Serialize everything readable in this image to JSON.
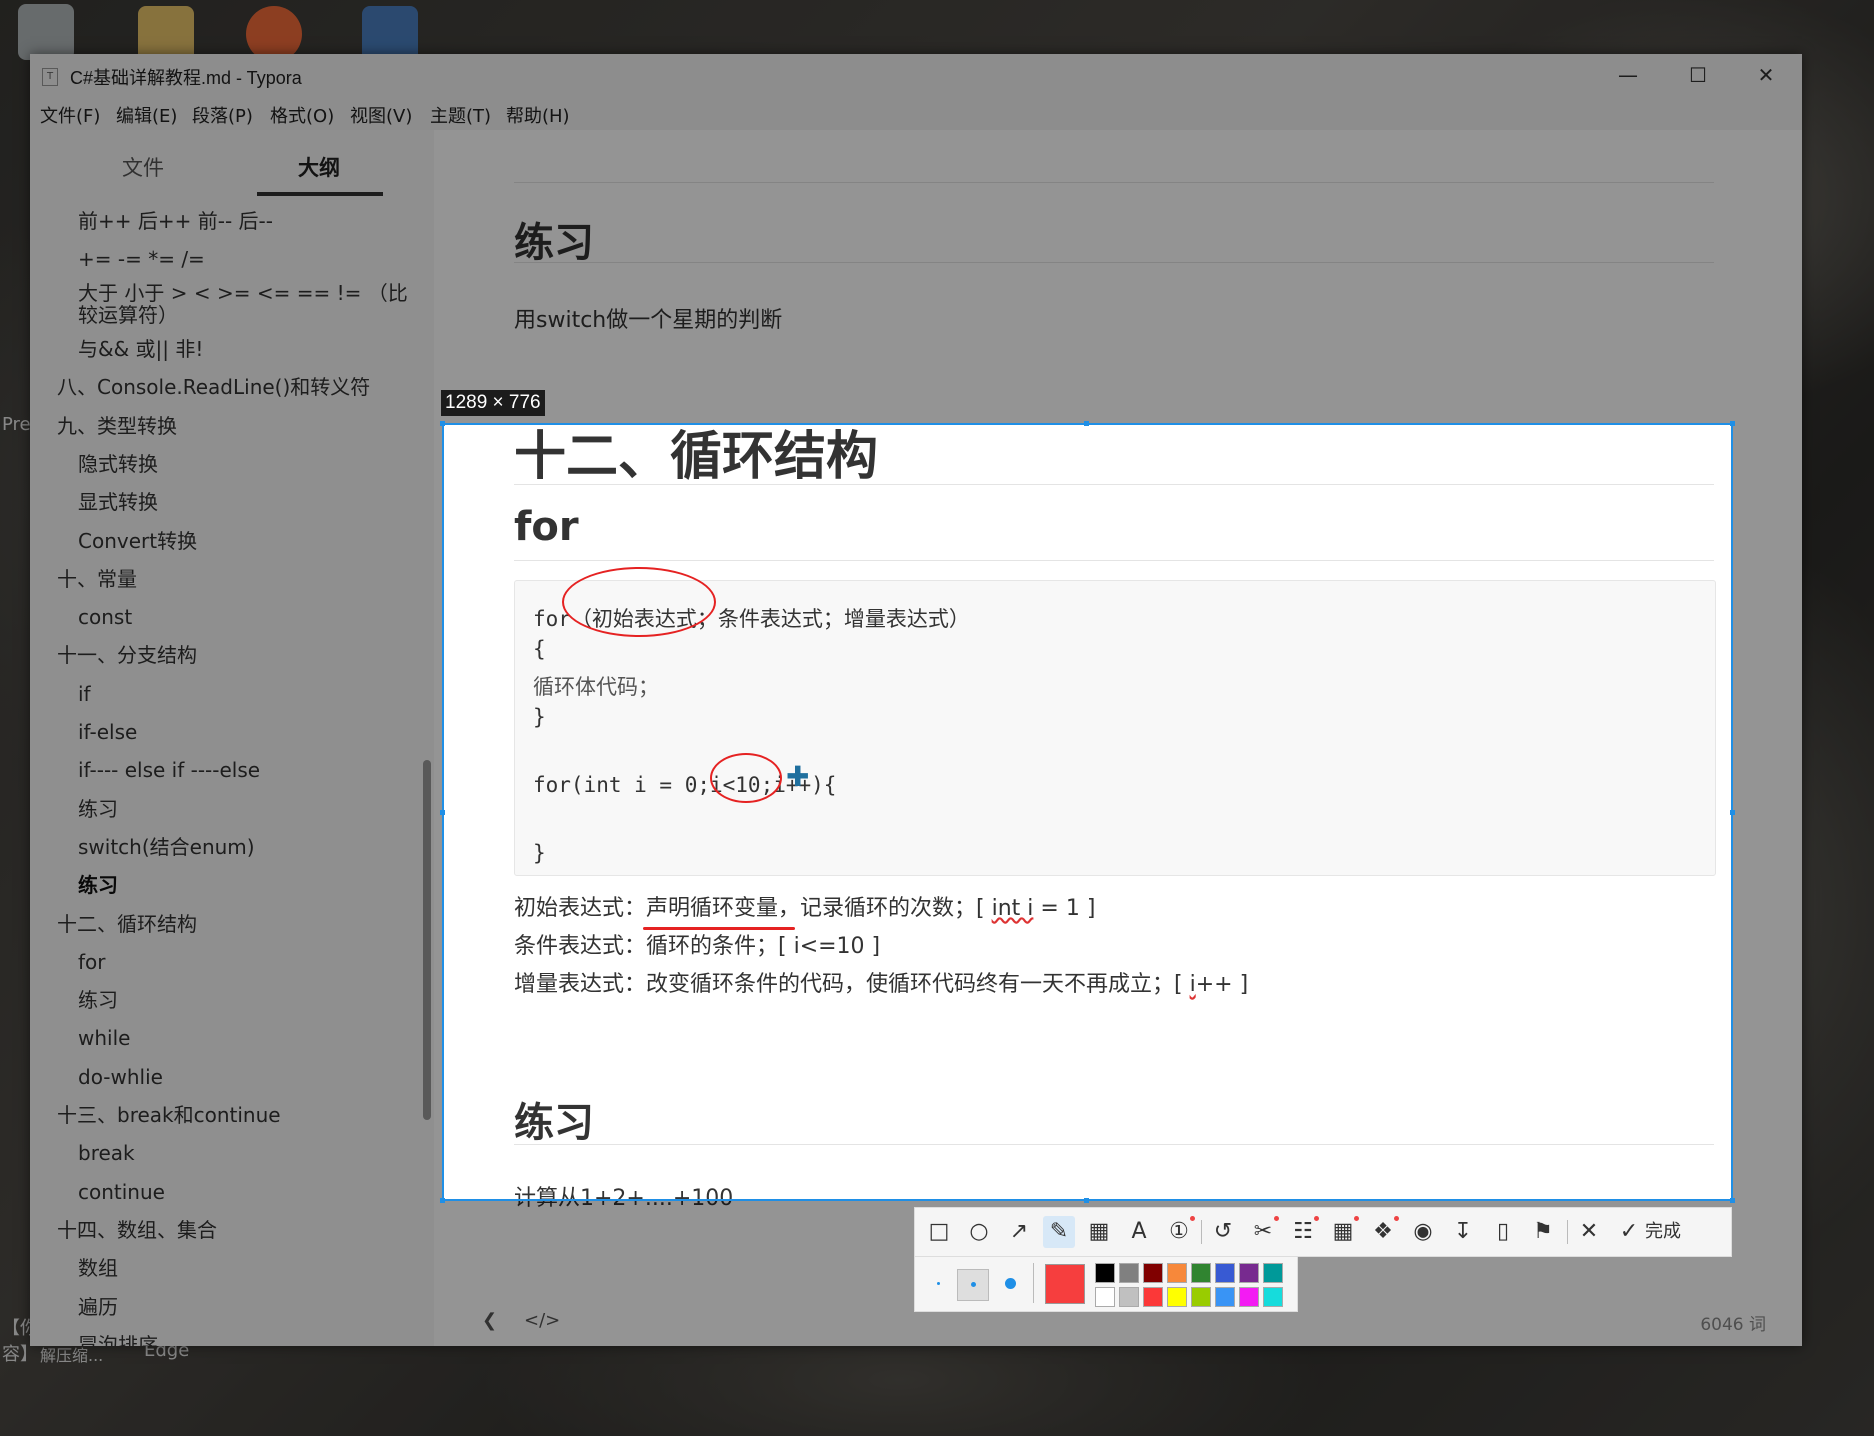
{
  "window": {
    "title": "C#基础详解教程.md - Typora"
  },
  "menu": [
    "文件(F)",
    "编辑(E)",
    "段落(P)",
    "格式(O)",
    "视图(V)",
    "主题(T)",
    "帮助(H)"
  ],
  "sidebar": {
    "tabs": [
      "文件",
      "大纲"
    ],
    "outline": [
      {
        "label": "前++ 后++ 前-- 后--",
        "level": 2
      },
      {
        "label": "+= -= *= /=",
        "level": 2
      },
      {
        "label": "大于 小于 > < >= <= == != （比",
        "level": 2
      },
      {
        "label": "较运算符）",
        "level": 2
      },
      {
        "label": "与&& 或|| 非!",
        "level": 2
      },
      {
        "label": "八、Console.ReadLine()和转义符",
        "level": 1
      },
      {
        "label": "九、类型转换",
        "level": 1
      },
      {
        "label": "隐式转换",
        "level": 2
      },
      {
        "label": "显式转换",
        "level": 2
      },
      {
        "label": "Convert转换",
        "level": 2
      },
      {
        "label": "十、常量",
        "level": 1
      },
      {
        "label": "const",
        "level": 2
      },
      {
        "label": "十一、分支结构",
        "level": 1
      },
      {
        "label": "if",
        "level": 2
      },
      {
        "label": "if-else",
        "level": 2
      },
      {
        "label": "if---- else if ----else",
        "level": 2
      },
      {
        "label": "练习",
        "level": 2
      },
      {
        "label": "switch(结合enum)",
        "level": 2
      },
      {
        "label": "练习",
        "level": 2,
        "active": true
      },
      {
        "label": "十二、循环结构",
        "level": 1
      },
      {
        "label": "for",
        "level": 2
      },
      {
        "label": "练习",
        "level": 2
      },
      {
        "label": "while",
        "level": 2
      },
      {
        "label": "do-whlie",
        "level": 2
      },
      {
        "label": "十三、break和continue",
        "level": 1
      },
      {
        "label": "break",
        "level": 2
      },
      {
        "label": "continue",
        "level": 2
      },
      {
        "label": "十四、数组、集合",
        "level": 1
      },
      {
        "label": "数组",
        "level": 2
      },
      {
        "label": "遍历",
        "level": 2
      },
      {
        "label": "冒泡排序",
        "level": 2
      }
    ]
  },
  "doc": {
    "h_practice1": "练习",
    "p_switch": "用switch做一个星期的判断",
    "h1_loop": "十二、循环结构",
    "h2_for": "for",
    "code": {
      "l1_kw": "for",
      "l1_rest": "（初始表达式；条件表达式；增量表达式）",
      "l2": "{",
      "l3": "循环体代码；",
      "l4": "}",
      "l6": "for(int i = 0;i<10;i++){",
      "l8": "}"
    },
    "p_init_a": "初始表达式：",
    "p_init_b": "声明循环变量",
    "p_init_c": "，记录循环的次数；[ ",
    "p_init_d": "int i",
    "p_init_e": " = 1 ]",
    "p_cond": "条件表达式：循环的条件；[ i<=10 ]",
    "p_inc_a": "增量表达式：改变循环条件的代码，使循环代码终有一天不再成立；[ ",
    "p_inc_b": "i",
    "p_inc_c": "++ ]",
    "h_practice2": "练习",
    "p_sum": "计算从1+2+....+100",
    "word_count": "6046 词"
  },
  "capture": {
    "size_label": "1289 × 776",
    "done_label": "完成",
    "current_color": "#f63e3e",
    "tools": [
      "rectangle-icon",
      "ellipse-icon",
      "arrow-icon",
      "pen-icon",
      "mosaic-icon",
      "text-icon",
      "number-icon",
      "undo-icon",
      "cut-icon",
      "translate-icon",
      "ocr-icon",
      "pin-icon",
      "record-icon",
      "download-icon",
      "phone-icon",
      "bookmark-icon",
      "close-icon",
      "check-icon"
    ],
    "palette": [
      "#000000",
      "#808080",
      "#800000",
      "#f7883a",
      "#308430",
      "#385ad3",
      "#772a8f",
      "#009999",
      "#ffffff",
      "#c0c0c0",
      "#fb3838",
      "#ffff00",
      "#99cc00",
      "#3994f5",
      "#f31bf3",
      "#16dcdc"
    ]
  },
  "desktop": {
    "labels": [
      "Pre",
      "Edge",
      "解压缩...",
      "容】",
      "【你"
    ]
  }
}
